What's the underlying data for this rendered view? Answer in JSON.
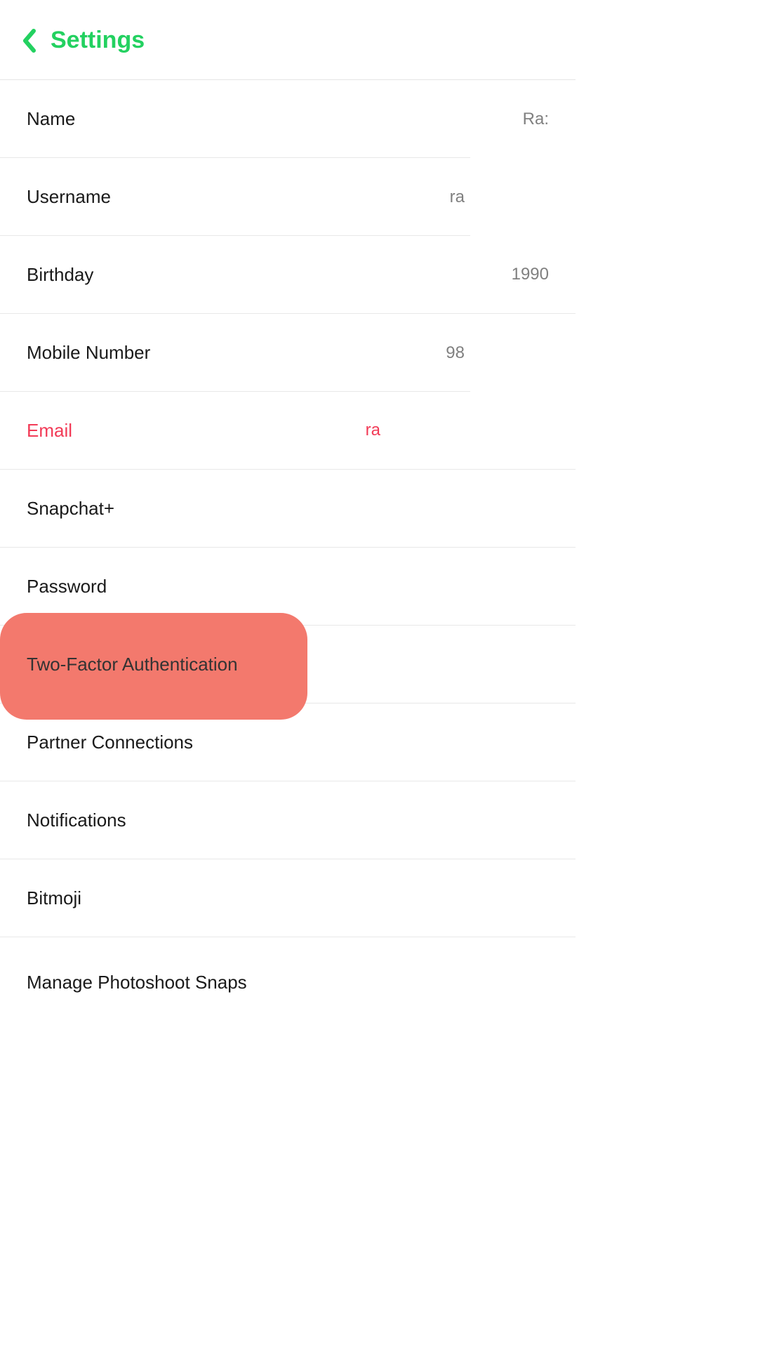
{
  "header": {
    "title": "Settings"
  },
  "rows": {
    "name": {
      "label": "Name",
      "value": "Ra:"
    },
    "username": {
      "label": "Username",
      "value": "ra"
    },
    "birthday": {
      "label": "Birthday",
      "value": "1990"
    },
    "mobile": {
      "label": "Mobile Number",
      "value": "98"
    },
    "email": {
      "label": "Email",
      "value": "ra"
    },
    "snapchat_plus": {
      "label": "Snapchat+",
      "value": ""
    },
    "password": {
      "label": "Password",
      "value": ""
    },
    "two_factor": {
      "label": "Two-Factor Authentication",
      "value": ""
    },
    "partner": {
      "label": "Partner Connections",
      "value": ""
    },
    "notifications": {
      "label": "Notifications",
      "value": ""
    },
    "bitmoji": {
      "label": "Bitmoji",
      "value": ""
    },
    "manage_snaps": {
      "label": "Manage Photoshoot Snaps",
      "value": ""
    }
  },
  "colors": {
    "accent": "#23d160",
    "highlight": "#f3796d",
    "pink": "#f23b57"
  }
}
